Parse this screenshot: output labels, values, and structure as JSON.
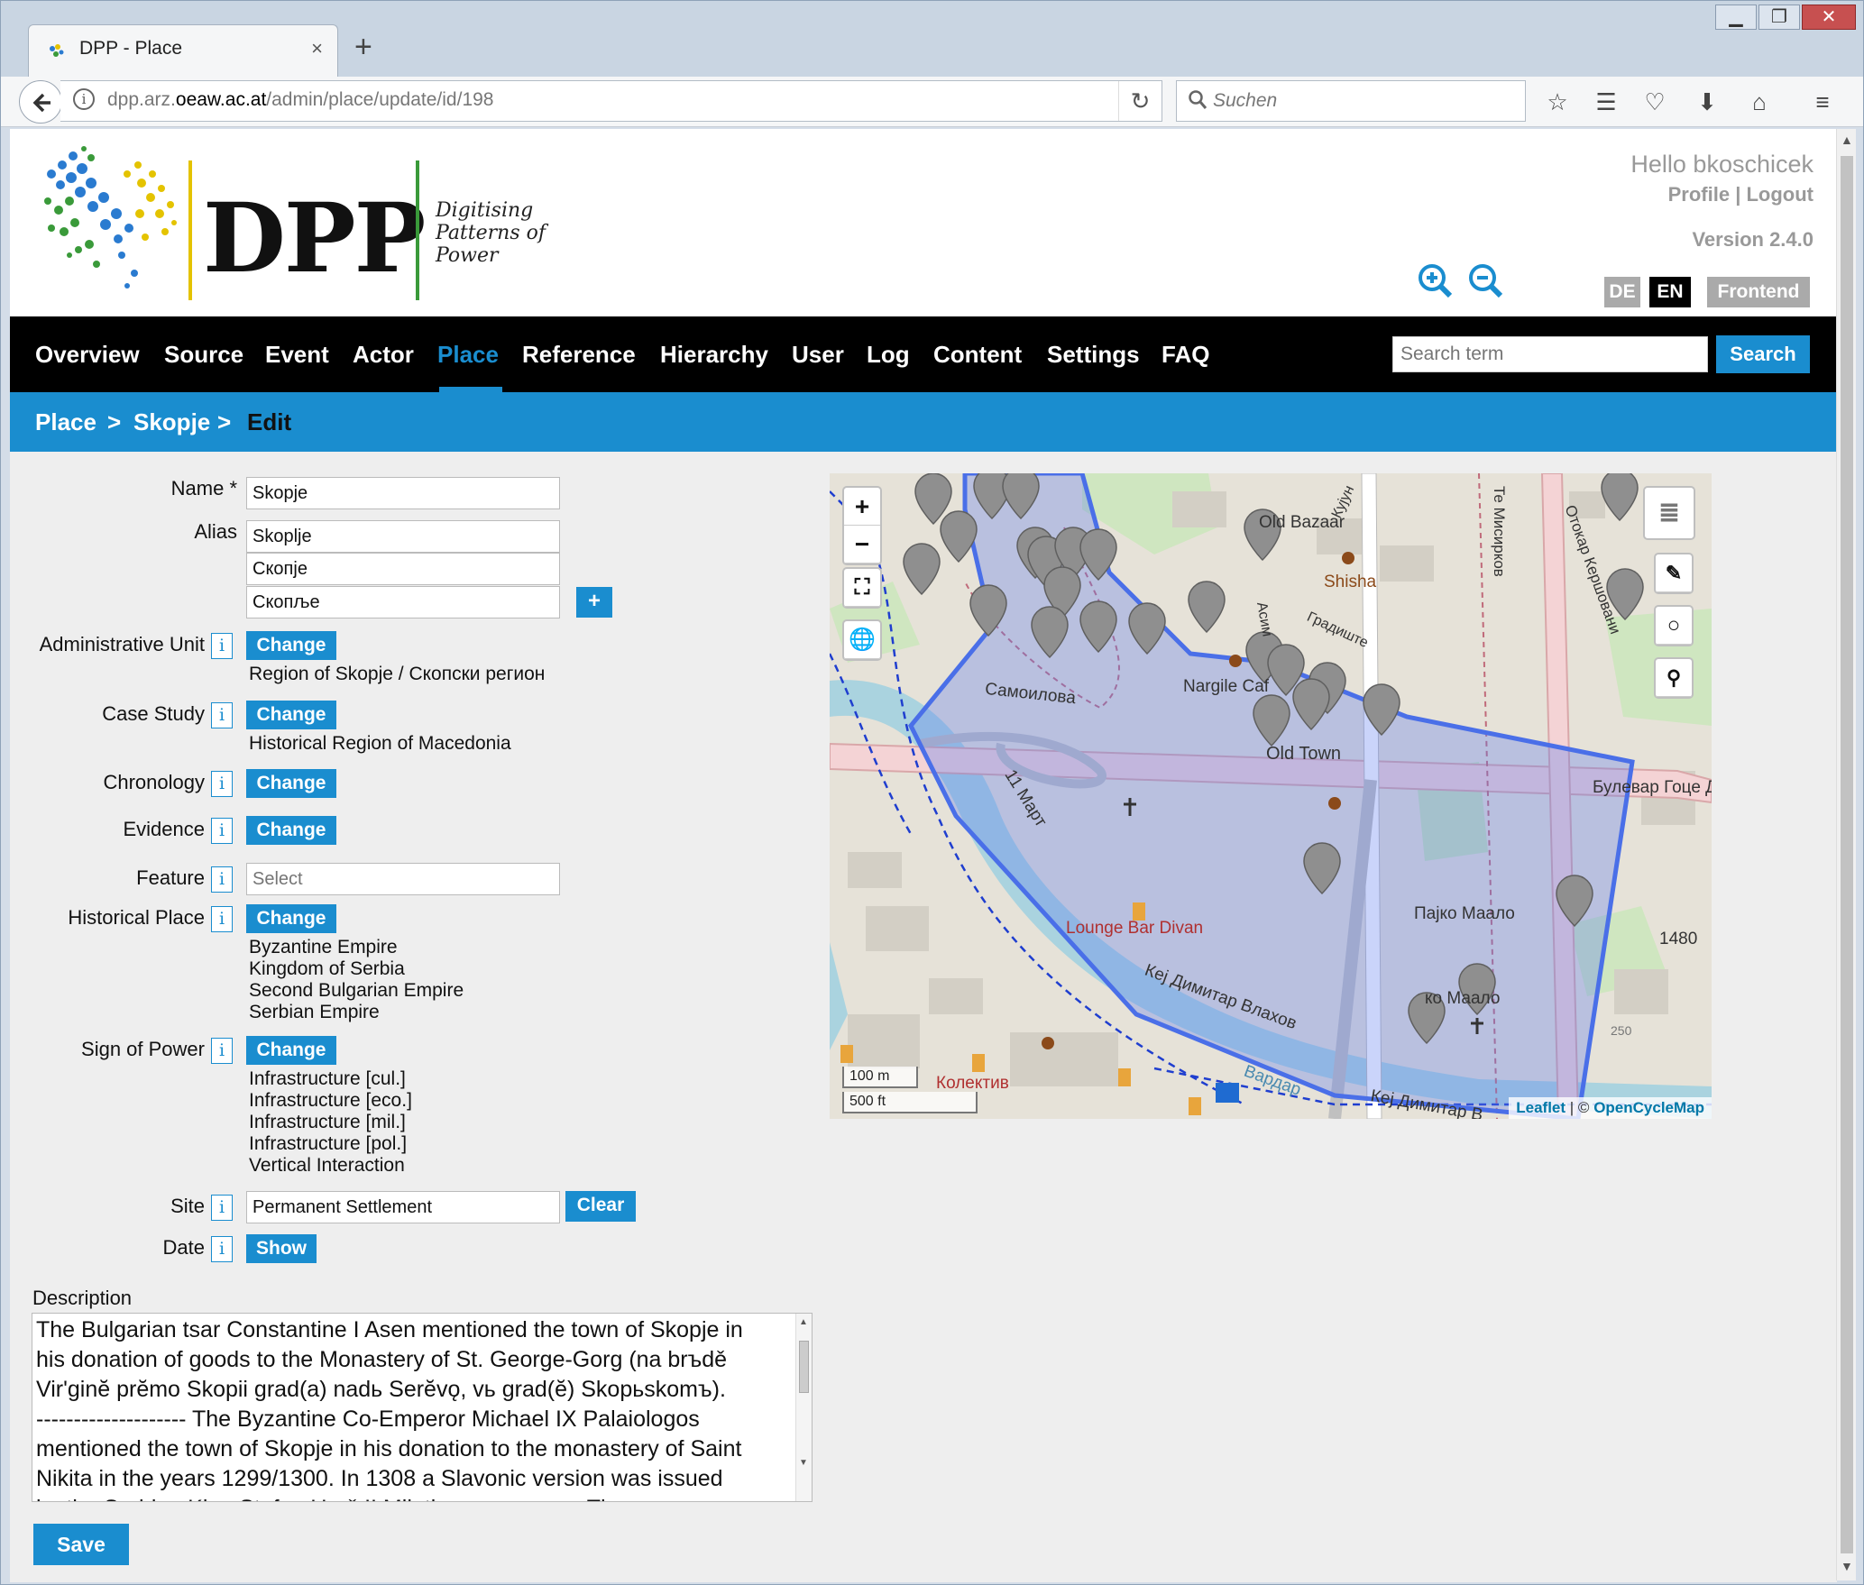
{
  "browser": {
    "tab_title": "DPP - Place",
    "url_prefix": "dpp.arz.",
    "url_domain": "oeaw.ac.at",
    "url_path": "/admin/place/update/id/198",
    "search_placeholder": "Suchen",
    "new_tab": "+",
    "tab_close": "×"
  },
  "header": {
    "logo_text": "DPP",
    "logo_sub_1": "Digitising",
    "logo_sub_2": "Patterns of",
    "logo_sub_3": "Power",
    "hello": "Hello bkoschicek",
    "profile": "Profile",
    "sep": "|",
    "logout": "Logout",
    "version": "Version 2.4.0",
    "lang_de": "DE",
    "lang_en": "EN",
    "frontend": "Frontend"
  },
  "nav": {
    "items": [
      "Overview",
      "Source",
      "Event",
      "Actor",
      "Place",
      "Reference",
      "Hierarchy",
      "User",
      "Log",
      "Content",
      "Settings",
      "FAQ"
    ],
    "active": "Place",
    "search_placeholder": "Search term",
    "search_button": "Search"
  },
  "breadcrumb": {
    "level1": "Place",
    "level2": "Skopje",
    "current": "Edit",
    "separator": ">"
  },
  "form": {
    "name_label": "Name *",
    "name_value": "Skopje",
    "alias_label": "Alias",
    "aliases": [
      "Skoplje",
      "Скопје",
      "Скопље"
    ],
    "add_alias": "+",
    "info_glyph": "i",
    "admin_unit_label": "Administrative Unit",
    "admin_unit_value": "Region of Skopje / Скопски регион",
    "case_study_label": "Case Study",
    "case_study_value": "Historical Region of Macedonia",
    "chronology_label": "Chronology",
    "evidence_label": "Evidence",
    "feature_label": "Feature",
    "feature_placeholder": "Select",
    "historical_place_label": "Historical Place",
    "historical_places": [
      "Byzantine Empire",
      "Kingdom of Serbia",
      "Second Bulgarian Empire",
      "Serbian Empire"
    ],
    "sign_of_power_label": "Sign of Power",
    "signs_of_power": [
      "Infrastructure [cul.]",
      "Infrastructure [eco.]",
      "Infrastructure [mil.]",
      "Infrastructure [pol.]",
      "Vertical Interaction"
    ],
    "site_label": "Site",
    "site_value": "Permanent Settlement",
    "clear_button": "Clear",
    "date_label": "Date",
    "show_button": "Show",
    "change_button": "Change",
    "description_label": "Description",
    "description_lines": [
      "The Bulgarian tsar Constantine I Asen mentioned the town of Skopje in",
      "his donation of goods to the Monastery of St. George-Gorg (na brъdě",
      "Vir'ginĕ prĕmo Skopii grad(a) nadь Serĕvǫ, vь grad(ĕ) Skopьskomъ).",
      "-------------------- The Byzantine Co-Emperor Michael IX Palaiologos",
      "mentioned the town of Skopje in his donation to the monastery of Saint",
      "Nikita in the years 1299/1300. In 1308 a Slavonic version was issued",
      "by the Serbian King Stefan Uroš II Milutin. ---------------- The"
    ],
    "save_button": "Save"
  },
  "map": {
    "zoom_in": "+",
    "zoom_out": "−",
    "scale_m": "100 m",
    "scale_ft": "500 ft",
    "attribution_leaflet": "Leaflet",
    "attribution_sep": "| ©",
    "attribution_osm": "OpenCycleMap",
    "labels": {
      "old_bazaar": "Old Bazaar",
      "shisha": "Shisha",
      "nargile": "Nargile Caf",
      "old_town": "Old Town",
      "samoilova": "Самоилова",
      "mart": "11 Март",
      "lounge": "Lounge Bar Divan",
      "kej": "Кеј Димитар Влахов",
      "kej2": "Кеј Димитар В",
      "pajko": "Пајко Маало",
      "pajko2": "ко Маало",
      "bulevar": "Булевар Гоце Д",
      "n1480": "1480",
      "vardar": "Вардар",
      "kolektiv": "Колектив",
      "misirkov": "Те Мисирков",
      "kershovani": "Отокар Кершовани",
      "gradishte": "Градиште",
      "asim": "Асим",
      "kujun": "Кујун",
      "n250": "250"
    }
  },
  "colors": {
    "accent": "#1a8dcf",
    "nav_bg": "#000000",
    "page_bg": "#eeeeee",
    "polygon": "#4a6fe8"
  }
}
